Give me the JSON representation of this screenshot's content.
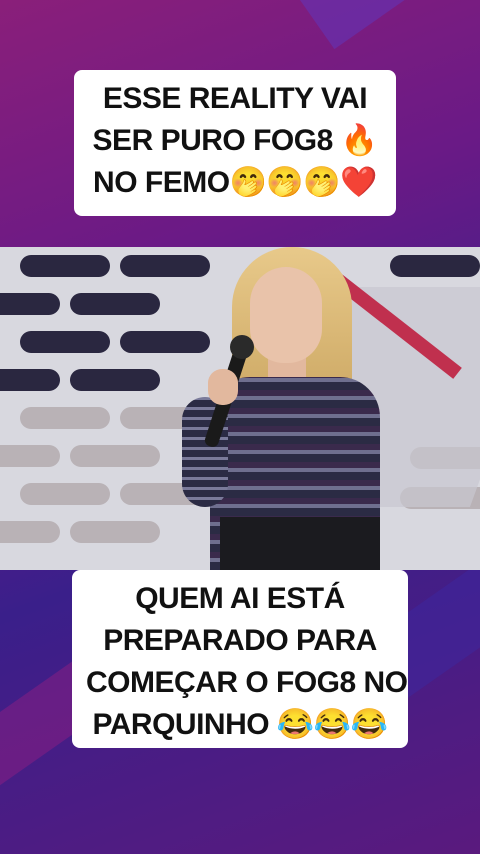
{
  "top_caption": {
    "line1": "ESSE REALITY VAI",
    "line2": "SER PURO FOG8 🔥",
    "line3": "NO FEMO🤭🤭🤭❤️"
  },
  "bottom_caption": {
    "line1": "QUEM AI ESTÁ",
    "line2": "PREPARADO PARA",
    "line3": "COMEÇAR O FOG8 NO",
    "line4": "PARQUINHO 😂😂😂"
  }
}
